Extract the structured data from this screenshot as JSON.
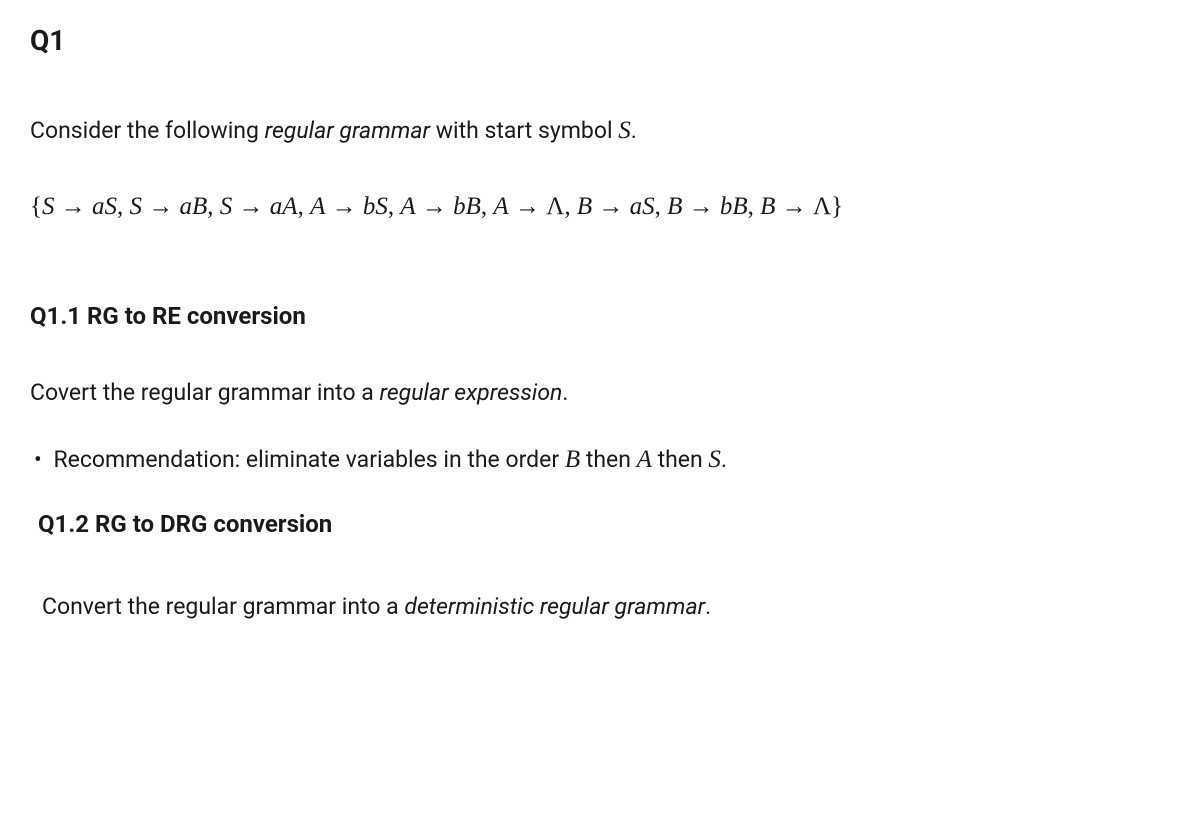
{
  "q1": {
    "title": "Q1",
    "intro_prefix": "Consider the following ",
    "intro_em": "regular grammar",
    "intro_mid": " with start symbol ",
    "intro_var": "S",
    "intro_suffix": ".",
    "grammar": {
      "open": "{",
      "rules": [
        {
          "lhs": "S",
          "rhs_term": "a",
          "rhs_var": "S"
        },
        {
          "lhs": "S",
          "rhs_term": "a",
          "rhs_var": "B"
        },
        {
          "lhs": "S",
          "rhs_term": "a",
          "rhs_var": "A"
        },
        {
          "lhs": "A",
          "rhs_term": "b",
          "rhs_var": "S"
        },
        {
          "lhs": "A",
          "rhs_term": "b",
          "rhs_var": "B"
        },
        {
          "lhs": "A",
          "rhs_term": "",
          "rhs_var": "Λ"
        },
        {
          "lhs": "B",
          "rhs_term": "a",
          "rhs_var": "S"
        },
        {
          "lhs": "B",
          "rhs_term": "b",
          "rhs_var": "B"
        },
        {
          "lhs": "B",
          "rhs_term": "",
          "rhs_var": "Λ"
        }
      ],
      "sep": ",  ",
      "arrow": "→",
      "close": "}"
    },
    "sub1": {
      "heading": "Q1.1 RG to RE conversion",
      "instruction_prefix": "Covert the regular grammar into a ",
      "instruction_em": "regular expression",
      "instruction_suffix": ".",
      "rec_prefix": "Recommendation: eliminate variables in the order ",
      "rec_var1": "B",
      "rec_mid1": " then ",
      "rec_var2": "A",
      "rec_mid2": " then ",
      "rec_var3": "S",
      "rec_suffix": "."
    },
    "sub2": {
      "heading": "Q1.2 RG to DRG conversion",
      "instruction_prefix": "Convert the regular grammar into a ",
      "instruction_em": "deterministic regular grammar",
      "instruction_suffix": "."
    }
  }
}
